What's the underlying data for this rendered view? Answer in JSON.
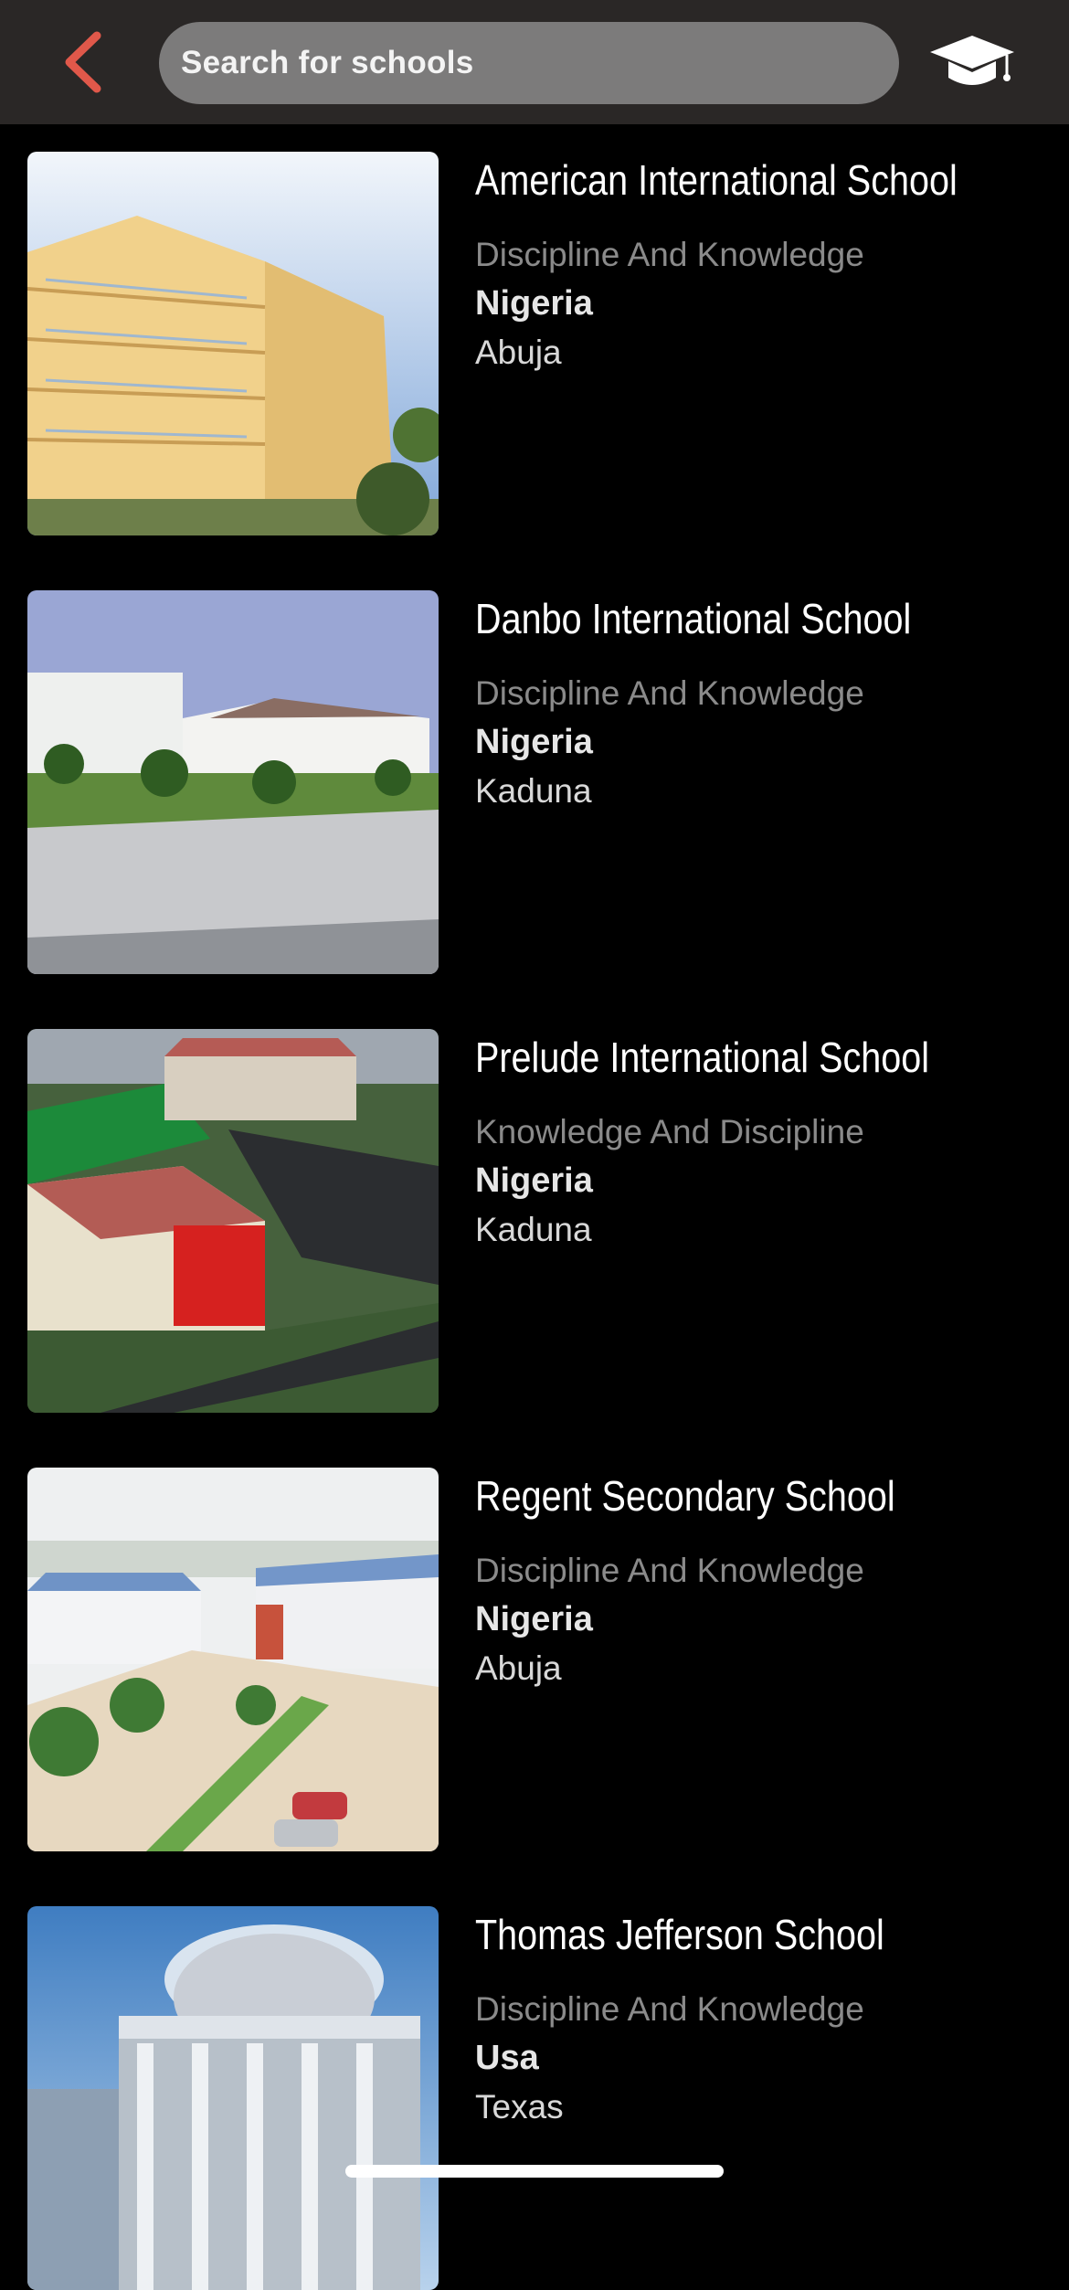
{
  "header": {
    "back_icon": "chevron-left-icon",
    "search_placeholder": "Search for schools",
    "cap_icon": "graduation-cap-icon",
    "accent": "#e0584a"
  },
  "schools": [
    {
      "name": "American International School",
      "motto": "Discipline And Knowledge",
      "country": "Nigeria",
      "city": "Abuja"
    },
    {
      "name": "Danbo International School",
      "motto": "Discipline And Knowledge",
      "country": "Nigeria",
      "city": "Kaduna"
    },
    {
      "name": "Prelude International School",
      "motto": "Knowledge And Discipline",
      "country": "Nigeria",
      "city": "Kaduna"
    },
    {
      "name": "Regent Secondary School",
      "motto": "Discipline And Knowledge",
      "country": "Nigeria",
      "city": "Abuja"
    },
    {
      "name": "Thomas Jefferson School",
      "motto": "Discipline And Knowledge",
      "country": "Usa",
      "city": "Texas"
    }
  ]
}
